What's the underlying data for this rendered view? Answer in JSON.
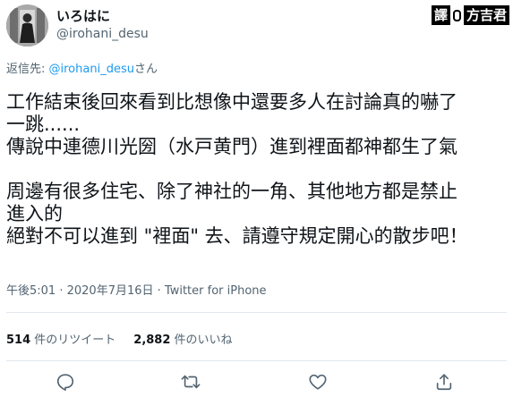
{
  "author": {
    "display_name": "いろはに",
    "handle": "@irohani_desu"
  },
  "watermark": {
    "left_text": "譯",
    "right_text": "方吉君"
  },
  "reply": {
    "prefix": "返信先: ",
    "mention": "@irohani_desu",
    "suffix": "さん"
  },
  "tweet": {
    "lines": [
      "工作結束後回來看到比想像中還要多人在討論真的嚇了",
      "一跳......",
      "傳說中連德川光圀（水戸黄門）進到裡面都神都生了氣",
      "",
      "周邊有很多住宅、除了神社的一角、其他地方都是禁止",
      "進入的",
      "絕對不可以進到 \"裡面\" 去、請遵守規定開心的散步吧！"
    ]
  },
  "meta": {
    "time": "午後5:01",
    "separator": " · ",
    "date": "2020年7月16日",
    "separator2": " · ",
    "source": "Twitter for iPhone"
  },
  "stats": {
    "retweet_count": "514",
    "retweet_label": " 件のリツイート",
    "like_count": "2,882",
    "like_label": " 件のいいね"
  },
  "actions": {
    "icons": [
      "reply-icon",
      "retweet-icon",
      "like-icon",
      "share-icon"
    ]
  },
  "colors": {
    "text": "#0f1419",
    "secondary": "#536471",
    "link": "#1d9bf0",
    "divider": "#e1e8ed"
  }
}
